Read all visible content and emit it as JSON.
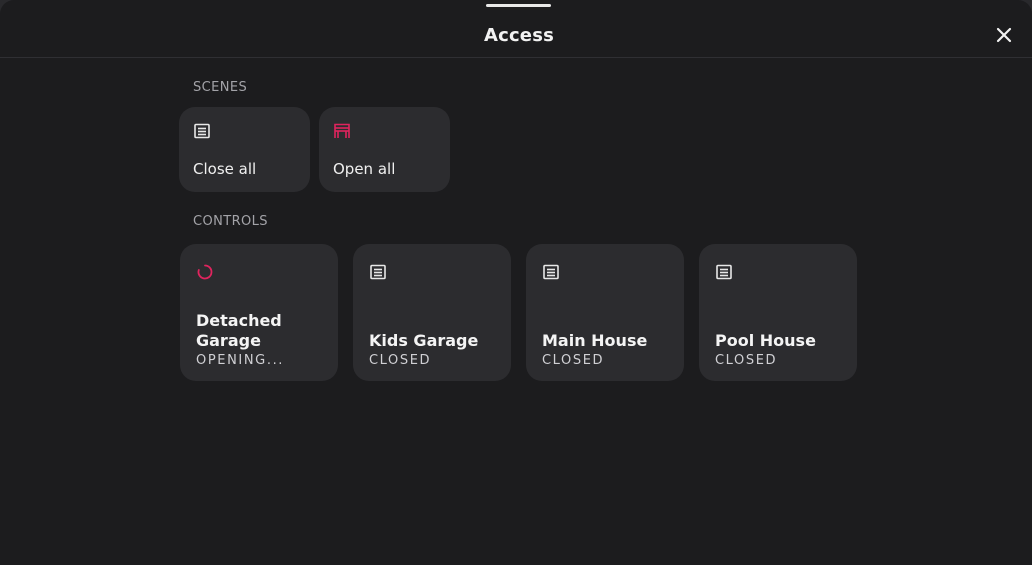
{
  "header": {
    "title": "Access",
    "close_icon": "close-icon"
  },
  "scenes": {
    "label": "SCENES",
    "items": [
      {
        "label": "Close all",
        "icon": "garage-closed-icon",
        "icon_color": "#e8e8e8"
      },
      {
        "label": "Open all",
        "icon": "garage-open-icon",
        "icon_color": "#e0245e"
      }
    ]
  },
  "controls": {
    "label": "CONTROLS",
    "items": [
      {
        "name": "Detached Garage",
        "state": "OPENING...",
        "icon": "loading-spinner-icon",
        "icon_color": "#e0245e"
      },
      {
        "name": "Kids Garage",
        "state": "CLOSED",
        "icon": "garage-closed-icon",
        "icon_color": "#e8e8e8"
      },
      {
        "name": "Main House",
        "state": "CLOSED",
        "icon": "garage-closed-icon",
        "icon_color": "#e8e8e8"
      },
      {
        "name": "Pool House",
        "state": "CLOSED",
        "icon": "garage-closed-icon",
        "icon_color": "#e8e8e8"
      }
    ]
  },
  "colors": {
    "accent": "#e0245e",
    "background": "#1c1c1e",
    "tile": "#2c2c2f"
  }
}
